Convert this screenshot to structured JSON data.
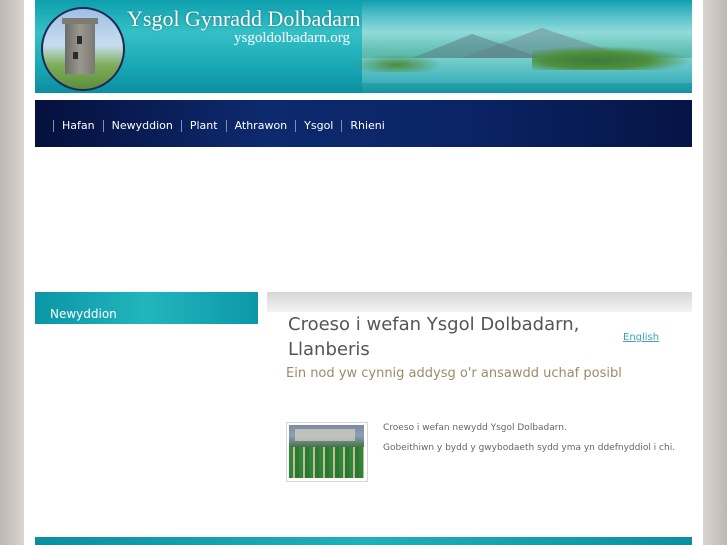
{
  "header": {
    "title": "Ysgol Gynradd Dolbadarn",
    "url": "ysgoldolbadarn.org",
    "logo_icon": "castle-logo-icon"
  },
  "nav": {
    "items": [
      "Hafan",
      "Newyddion",
      "Plant",
      "Athrawon",
      "Ysgol",
      "Rhieni"
    ]
  },
  "sidebar": {
    "heading": "Newyddion"
  },
  "main": {
    "heading": "Croeso i wefan Ysgol Dolbadarn, Llanberis",
    "language_link": "English",
    "subtitle": "Ein nod yw cynnig addysg o'r ansawdd uchaf posibl",
    "paragraphs": [
      "Croeso i wefan newydd Ysgol Dolbadarn.",
      "Gobeithiwn y bydd y gwybodaeth sydd yma yn ddefnyddiol i chi."
    ],
    "photo_icon": "school-photo"
  },
  "colors": {
    "banner": "#22b5bd",
    "nav": "#0d2a6e",
    "accent": "#3aa6b3",
    "subtitle": "#9a8c6a"
  }
}
